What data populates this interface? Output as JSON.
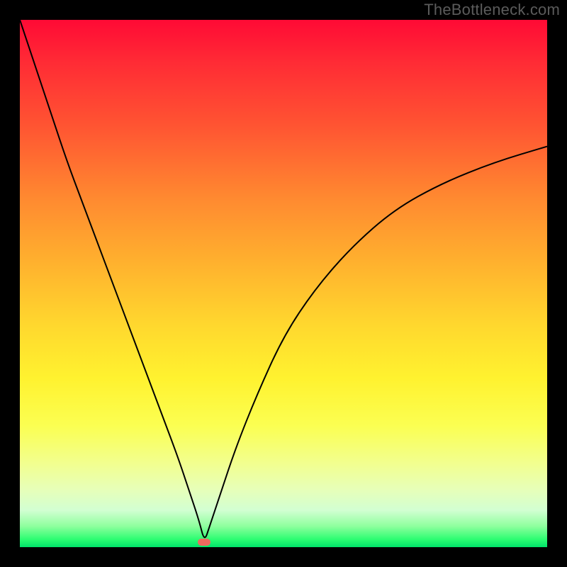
{
  "watermark": "TheBottleneck.com",
  "colors": {
    "frame": "#000000",
    "curve": "#000000",
    "marker": "#ef6a5f",
    "gradient_top": "#ff0a35",
    "gradient_bottom": "#00e26a"
  },
  "chart_data": {
    "type": "line",
    "title": "",
    "xlabel": "",
    "ylabel": "",
    "xlim": [
      0,
      100
    ],
    "ylim": [
      0,
      100
    ],
    "grid": false,
    "legend": false,
    "annotations": [],
    "minimum_at_x": 35,
    "marker": {
      "x": 35,
      "y": 1
    },
    "background": "rainbow-gradient (red top → green bottom)",
    "series": [
      {
        "name": "bottleneck-curve",
        "x": [
          0,
          3,
          6,
          9,
          12,
          15,
          18,
          21,
          24,
          27,
          30,
          32,
          34,
          35,
          36,
          38,
          41,
          45,
          50,
          56,
          63,
          71,
          80,
          90,
          100
        ],
        "y": [
          100,
          91,
          82,
          73,
          65,
          57,
          49,
          41,
          33,
          25,
          17,
          11,
          5,
          1,
          4,
          10,
          19,
          29,
          40,
          49,
          57,
          64,
          69,
          73,
          76
        ]
      }
    ]
  }
}
